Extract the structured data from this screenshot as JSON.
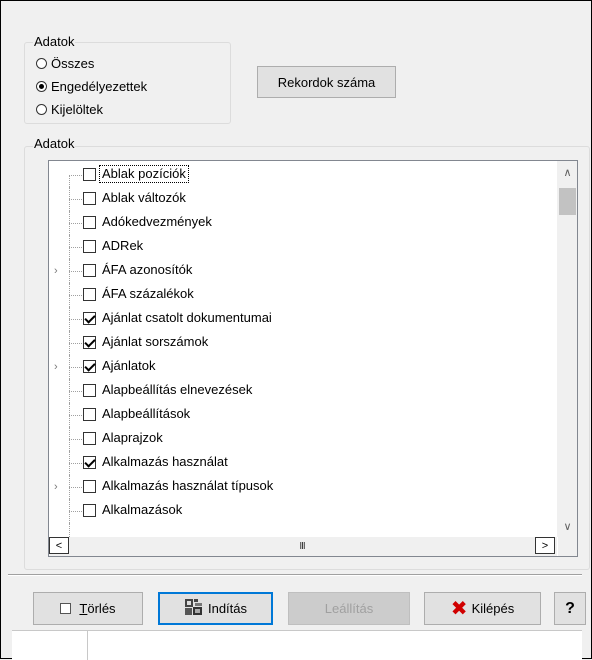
{
  "filter_group": {
    "title": "Adatok",
    "options": [
      {
        "label": "Összes",
        "selected": false
      },
      {
        "label": "Engedélyezettek",
        "selected": true
      },
      {
        "label": "Kijelöltek",
        "selected": false
      }
    ],
    "count_button": "Rekordok száma"
  },
  "list_group": {
    "title": "Adatok",
    "items": [
      {
        "label": "Ablak pozíciók",
        "checked": false,
        "expandable": false,
        "focused": true
      },
      {
        "label": "Ablak változók",
        "checked": false,
        "expandable": false
      },
      {
        "label": "Adókedvezmények",
        "checked": false,
        "expandable": false
      },
      {
        "label": "ADRek",
        "checked": false,
        "expandable": false
      },
      {
        "label": "ÁFA azonosítók",
        "checked": false,
        "expandable": true
      },
      {
        "label": "ÁFA százalékok",
        "checked": false,
        "expandable": false
      },
      {
        "label": "Ajánlat csatolt dokumentumai",
        "checked": true,
        "expandable": false
      },
      {
        "label": "Ajánlat sorszámok",
        "checked": true,
        "expandable": false
      },
      {
        "label": "Ajánlatok",
        "checked": true,
        "expandable": true
      },
      {
        "label": "Alapbeállítás elnevezések",
        "checked": false,
        "expandable": false
      },
      {
        "label": "Alapbeállítások",
        "checked": false,
        "expandable": false
      },
      {
        "label": "Alaprajzok",
        "checked": false,
        "expandable": false
      },
      {
        "label": "Alkalmazás használat",
        "checked": true,
        "expandable": false
      },
      {
        "label": "Alkalmazás használat típusok",
        "checked": false,
        "expandable": true
      },
      {
        "label": "Alkalmazások",
        "checked": false,
        "expandable": false
      }
    ],
    "hscroll_thumb_glyph": "III"
  },
  "buttons": {
    "clear": {
      "underline": "T",
      "rest": "örlés"
    },
    "start": "Indítás",
    "stop": "Leállítás",
    "exit": "Kilépés",
    "help": "?"
  },
  "icons": {
    "x_color": "#d00000",
    "focus_color": "#0078d7"
  }
}
